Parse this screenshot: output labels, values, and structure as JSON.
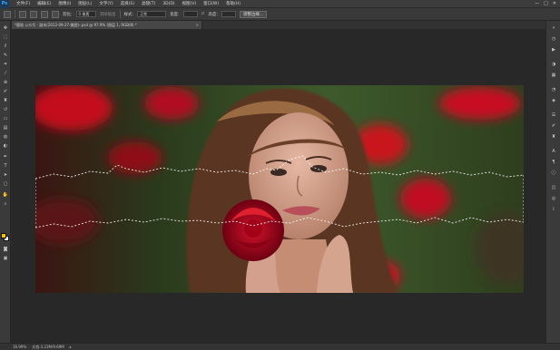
{
  "app": {
    "logo": "Ps"
  },
  "menubar": {
    "items": [
      "文件(F)",
      "编辑(E)",
      "图像(I)",
      "图层(L)",
      "文字(Y)",
      "选择(S)",
      "滤镜(T)",
      "3D(D)",
      "视图(V)",
      "窗口(W)",
      "帮助(H)"
    ],
    "controls": [
      "—",
      "□",
      "✕"
    ]
  },
  "options": {
    "feather_label": "羽化:",
    "feather_value": "0 像素",
    "antialias_label": "消除锯齿",
    "style_label": "样式:",
    "style_value": "正常",
    "width_label": "宽度:",
    "height_label": "高度:",
    "refine_edge_button": "调整边缘..."
  },
  "document": {
    "tab_title": "*鹿晗 公众号 - 副本(2012-09-27-美图)-.psd @ 97.9% (图层 1, RGB/8) *",
    "tab_close": "×"
  },
  "status": {
    "zoom": "16.99%",
    "doc_size": "文档:3.23M/9.69M",
    "arrow": "▸"
  },
  "colors": {
    "foreground": "#f2c300",
    "background": "#ffffff",
    "accent": "#31a8ff"
  },
  "left_tools": [
    "move-icon",
    "marquee-icon",
    "lasso-icon",
    "quick-select-icon",
    "crop-icon",
    "eyedropper-icon",
    "healing-icon",
    "brush-icon",
    "stamp-icon",
    "history-brush-icon",
    "eraser-icon",
    "gradient-icon",
    "blur-icon",
    "dodge-icon",
    "pen-icon",
    "type-icon",
    "path-select-icon",
    "shape-icon",
    "hand-icon",
    "zoom-icon"
  ],
  "right_tools": [
    "collapse-icon",
    "history-icon",
    "actions-icon",
    "color-icon",
    "swatches-icon",
    "adjustments-icon",
    "styles-icon",
    "properties-icon",
    "brush-panel-icon",
    "clone-source-icon",
    "character-icon",
    "paragraph-icon",
    "info-icon",
    "layers-icon",
    "channels-icon",
    "paths-icon"
  ]
}
